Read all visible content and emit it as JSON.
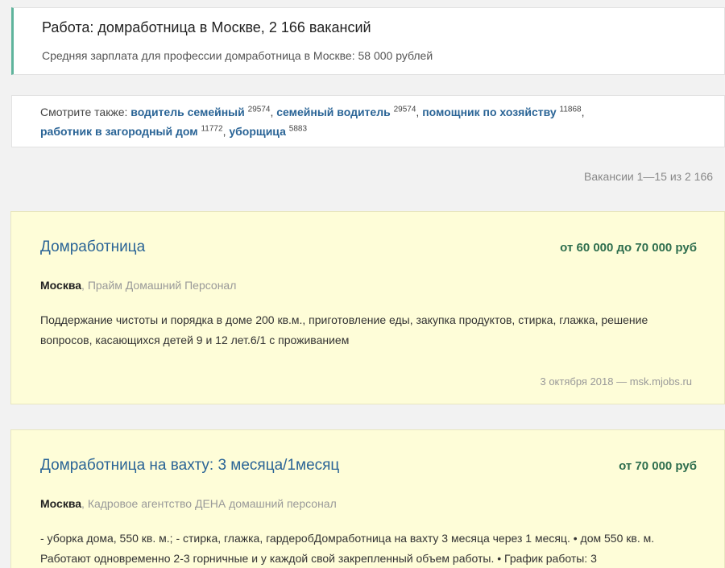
{
  "header": {
    "title": "Работа: домработница в Москве, 2 166 вакансий",
    "salary_note": "Средняя зарплата для профессии домработница в Москве: 58 000 рублей"
  },
  "see_also": {
    "label": "Смотрите также:",
    "links": [
      {
        "text": "водитель семейный",
        "count": "29574"
      },
      {
        "text": "семейный водитель",
        "count": "29574"
      },
      {
        "text": "помощник по хозяйству",
        "count": "11868"
      },
      {
        "text": "работник в загородный дом",
        "count": "11772"
      },
      {
        "text": "уборщица",
        "count": "5883"
      }
    ]
  },
  "results": {
    "count_text": "Вакансии 1—15 из 2 166"
  },
  "vacancies": [
    {
      "title": "Домработница",
      "salary": "от 60 000 до 70 000 руб",
      "city": "Москва",
      "company": "Прайм Домашний Персонал",
      "description": "Поддержание чистоты и порядка в доме 200 кв.м., приготовление еды, закупка продуктов, стирка, глажка, решение вопросов, касающихся детей 9 и 12 лет.6/1 с проживанием",
      "date_source": "3 октября 2018 — msk.mjobs.ru"
    },
    {
      "title": "Домработница на вахту: 3 месяца/1месяц",
      "salary": "от 70 000 руб",
      "city": "Москва",
      "company": "Кадровое агентство ДЕНА домашний персонал",
      "description": "- уборка дома, 550 кв. м.; - стирка, глажка, гардеробДомработница на вахту 3 месяца через 1 месяц. • дом 550 кв. м. Работают одновременно 2-3 горничные и у каждой свой закрепленный объем работы. • График работы: 3"
    }
  ]
}
